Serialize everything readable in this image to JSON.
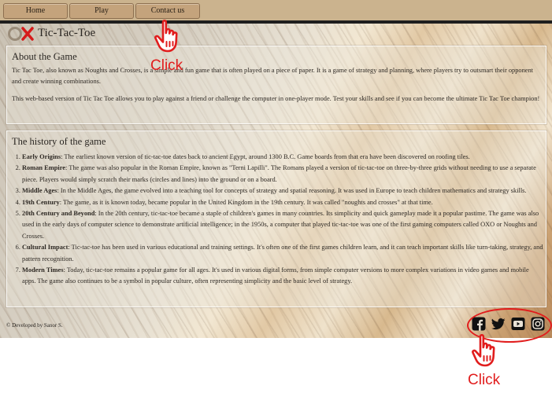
{
  "nav": {
    "home": "Home",
    "play": "Play",
    "contact": "Contact us"
  },
  "header": {
    "title": "Tic-Tac-Toe",
    "logo_icon": "tic-tac-toe-logo-icon"
  },
  "about": {
    "heading": "About the Game",
    "p1": "Tic Tac Toe, also known as Noughts and Crosses, is a simple and fun game that is often played on a piece of paper. It is a game of strategy and planning, where players try to outsmart their opponent and create winning combinations.",
    "p2": "This web-based version of Tic Tac Toe allows you to play against a friend or challenge the computer in one-player mode. Test your skills and see if you can become the ultimate Tic Tac Toe champion!"
  },
  "history": {
    "heading": "The history of the game",
    "items": [
      {
        "term": "Early Origins",
        "text": ": The earliest known version of tic-tac-toe dates back to ancient Egypt, around 1300 B.C. Game boards from that era have been discovered on roofing tiles."
      },
      {
        "term": "Roman Empire",
        "text": ": The game was also popular in the Roman Empire, known as \"Terni Lapilli\". The Romans played a version of tic-tac-toe on three-by-three grids without needing to use a separate piece. Players would simply scratch their marks (circles and lines) into the ground or on a board."
      },
      {
        "term": "Middle Ages",
        "text": ": In the Middle Ages, the game evolved into a teaching tool for concepts of strategy and spatial reasoning. It was used in Europe to teach children mathematics and strategy skills."
      },
      {
        "term": "19th Century",
        "text": ": The game, as it is known today, became popular in the United Kingdom in the 19th century. It was called \"noughts and crosses\" at that time."
      },
      {
        "term": "20th Century and Beyond",
        "text": ": In the 20th century, tic-tac-toe became a staple of children's games in many countries. Its simplicity and quick gameplay made it a popular pastime. The game was also used in the early days of computer science to demonstrate artificial intelligence; in the 1950s, a computer that played tic-tac-toe was one of the first gaming computers called OXO or Noughts and Crosses."
      },
      {
        "term": "Cultural Impact",
        "text": ": Tic-tac-toe has been used in various educational and training settings. It's often one of the first games children learn, and it can teach important skills like turn-taking, strategy, and pattern recognition."
      },
      {
        "term": "Modern Times",
        "text": ": Today, tic-tac-toe remains a popular game for all ages. It's used in various digital forms, from simple computer versions to more complex variations in video games and mobile apps. The game also continues to be a symbol in popular culture, often representing simplicity and the basic level of strategy."
      }
    ]
  },
  "footer": {
    "copyright": "© Developed by Sanor S.",
    "social_icons": [
      "facebook-icon",
      "twitter-icon",
      "youtube-icon",
      "instagram-icon"
    ]
  },
  "annotations": {
    "click_label_1": "Click",
    "click_label_2": "Click",
    "highlight_color": "#e11d1d"
  }
}
